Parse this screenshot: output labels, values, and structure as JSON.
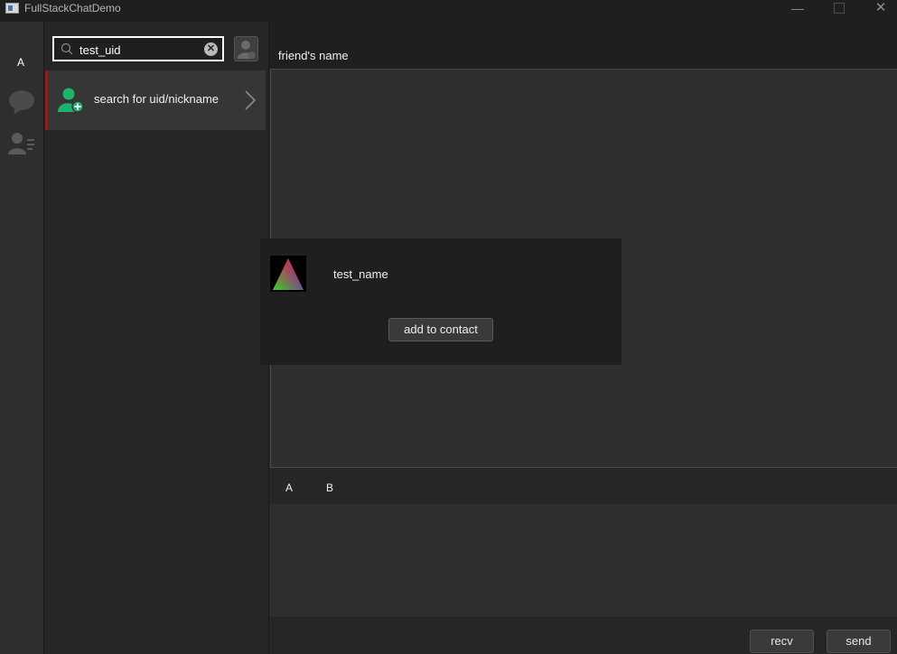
{
  "window": {
    "title": "FullStackChatDemo",
    "minimize_glyph": "—",
    "close_glyph": "✕"
  },
  "sidebar": {
    "avatar_label": "A",
    "icons": [
      "chat-bubble-icon",
      "contacts-icon"
    ]
  },
  "search": {
    "value": "test_uid",
    "placeholder": "",
    "clear_glyph": "✕"
  },
  "search_result": {
    "label": "search for uid/nickname"
  },
  "chat": {
    "friend_name": "friend's name",
    "tools": [
      "A",
      "B"
    ],
    "recv_label": "recv",
    "send_label": "send"
  },
  "popup": {
    "name": "test_name",
    "add_label": "add to contact"
  },
  "colors": {
    "accent_green": "#1db36b",
    "selected_marker": "#8a1f1f",
    "background": "#2b2b2b"
  }
}
